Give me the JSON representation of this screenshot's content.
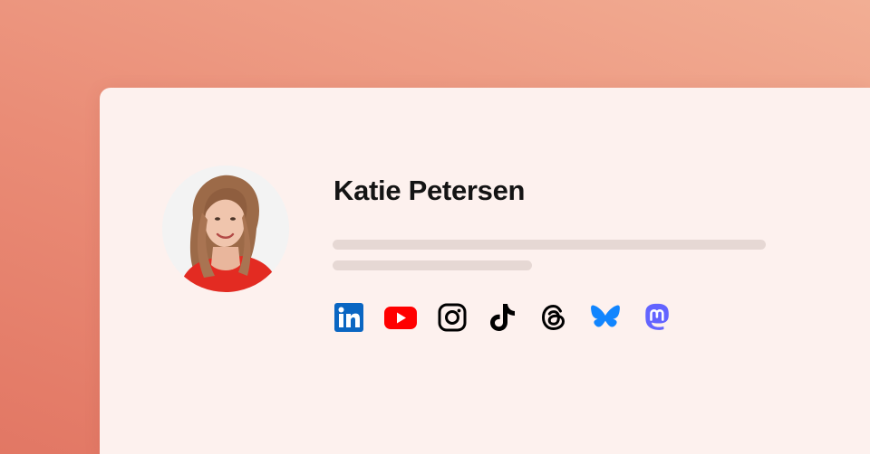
{
  "profile": {
    "name": "Katie Petersen"
  },
  "socials": [
    {
      "icon": "linkedin-icon",
      "color": "#0a66c2"
    },
    {
      "icon": "youtube-icon",
      "color": "#ff0000"
    },
    {
      "icon": "instagram-icon",
      "color": "#000000"
    },
    {
      "icon": "tiktok-icon",
      "color": "#000000"
    },
    {
      "icon": "threads-icon",
      "color": "#000000"
    },
    {
      "icon": "bluesky-icon",
      "color": "#1185fe"
    },
    {
      "icon": "mastodon-icon",
      "color": "#6364ff"
    }
  ],
  "colors": {
    "background": "#ea8d77",
    "card": "#fdf1ee",
    "placeholder_line": "#e6d8d4"
  }
}
